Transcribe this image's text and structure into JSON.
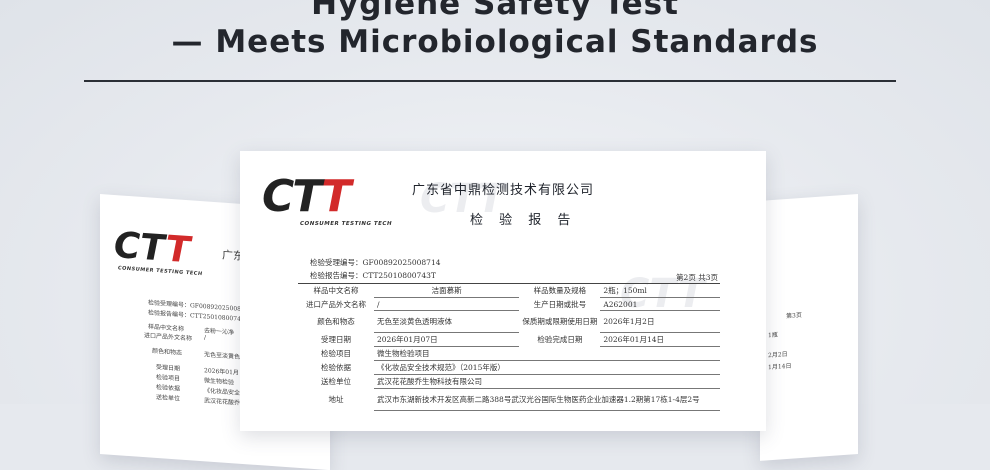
{
  "headline": {
    "line1": "Hygiene Safety Test",
    "line2": "— Meets Microbiological Standards"
  },
  "report": {
    "logo": {
      "letters": [
        "C",
        "T",
        "T"
      ],
      "tagline": "CONSUMER TESTING TECH"
    },
    "company": "广东省中鼎检测技术有限公司",
    "title": "检 验 报 告",
    "acceptance_no_label": "检验受理编号：",
    "acceptance_no": "GF00892025008714",
    "report_no_label": "检验报告编号：",
    "report_no": "CTT25010800743T",
    "page": "第2页   共3页",
    "rows": [
      {
        "label": "样品中文名称",
        "value": "洁面慕斯",
        "label2": "样品数量及规格",
        "value2": "2瓶；150ml"
      },
      {
        "label": "进口产品外文名称",
        "value": "/",
        "label2": "生产日期或批号",
        "value2": "A262001"
      },
      {
        "label": "颜色和物态",
        "value": "无色至淡黄色透明液体",
        "label2": "保质期或限期使用日期",
        "value2": "2026年1月2日"
      },
      {
        "label": "受理日期",
        "value": "2026年01月07日",
        "label2": "检验完成日期",
        "value2": "2026年01月14日"
      },
      {
        "label": "检验项目",
        "value": "微生物检验项目"
      },
      {
        "label": "检验依据",
        "value": "《化妆品安全技术规范》（2015年版）"
      },
      {
        "label": "送检单位",
        "value": "武汉花花酸乔生物科技有限公司"
      },
      {
        "label": "地址",
        "value": "武汉市东湖新技术开发区高新二路388号武汉光谷国际生物医药企业加速器1.2期第17栋1-4层2号"
      }
    ]
  },
  "left_sheet": {
    "logo": {
      "letters": [
        "C",
        "T",
        "T"
      ],
      "tagline": "CONSUMER TESTING TECH"
    },
    "company_partial": "广东",
    "lines": [
      "检验受理编号：GF0089202500871",
      "检验报告编号：CTT25010800743",
      "样品中文名称",
      "进口产品外文名称",
      "颜色和物态",
      "受理日期",
      "检验项目",
      "检验依据",
      "送检单位"
    ],
    "values": [
      "去粉一沁净",
      "/",
      "无色至淡黄色",
      "2026年01月",
      "微生物检验",
      "《化妆品安全",
      "武汉花花酸乔"
    ]
  },
  "right_sheet": {
    "lines": [
      "第3页",
      "1瓶",
      "2月2日",
      "1月14日"
    ]
  }
}
